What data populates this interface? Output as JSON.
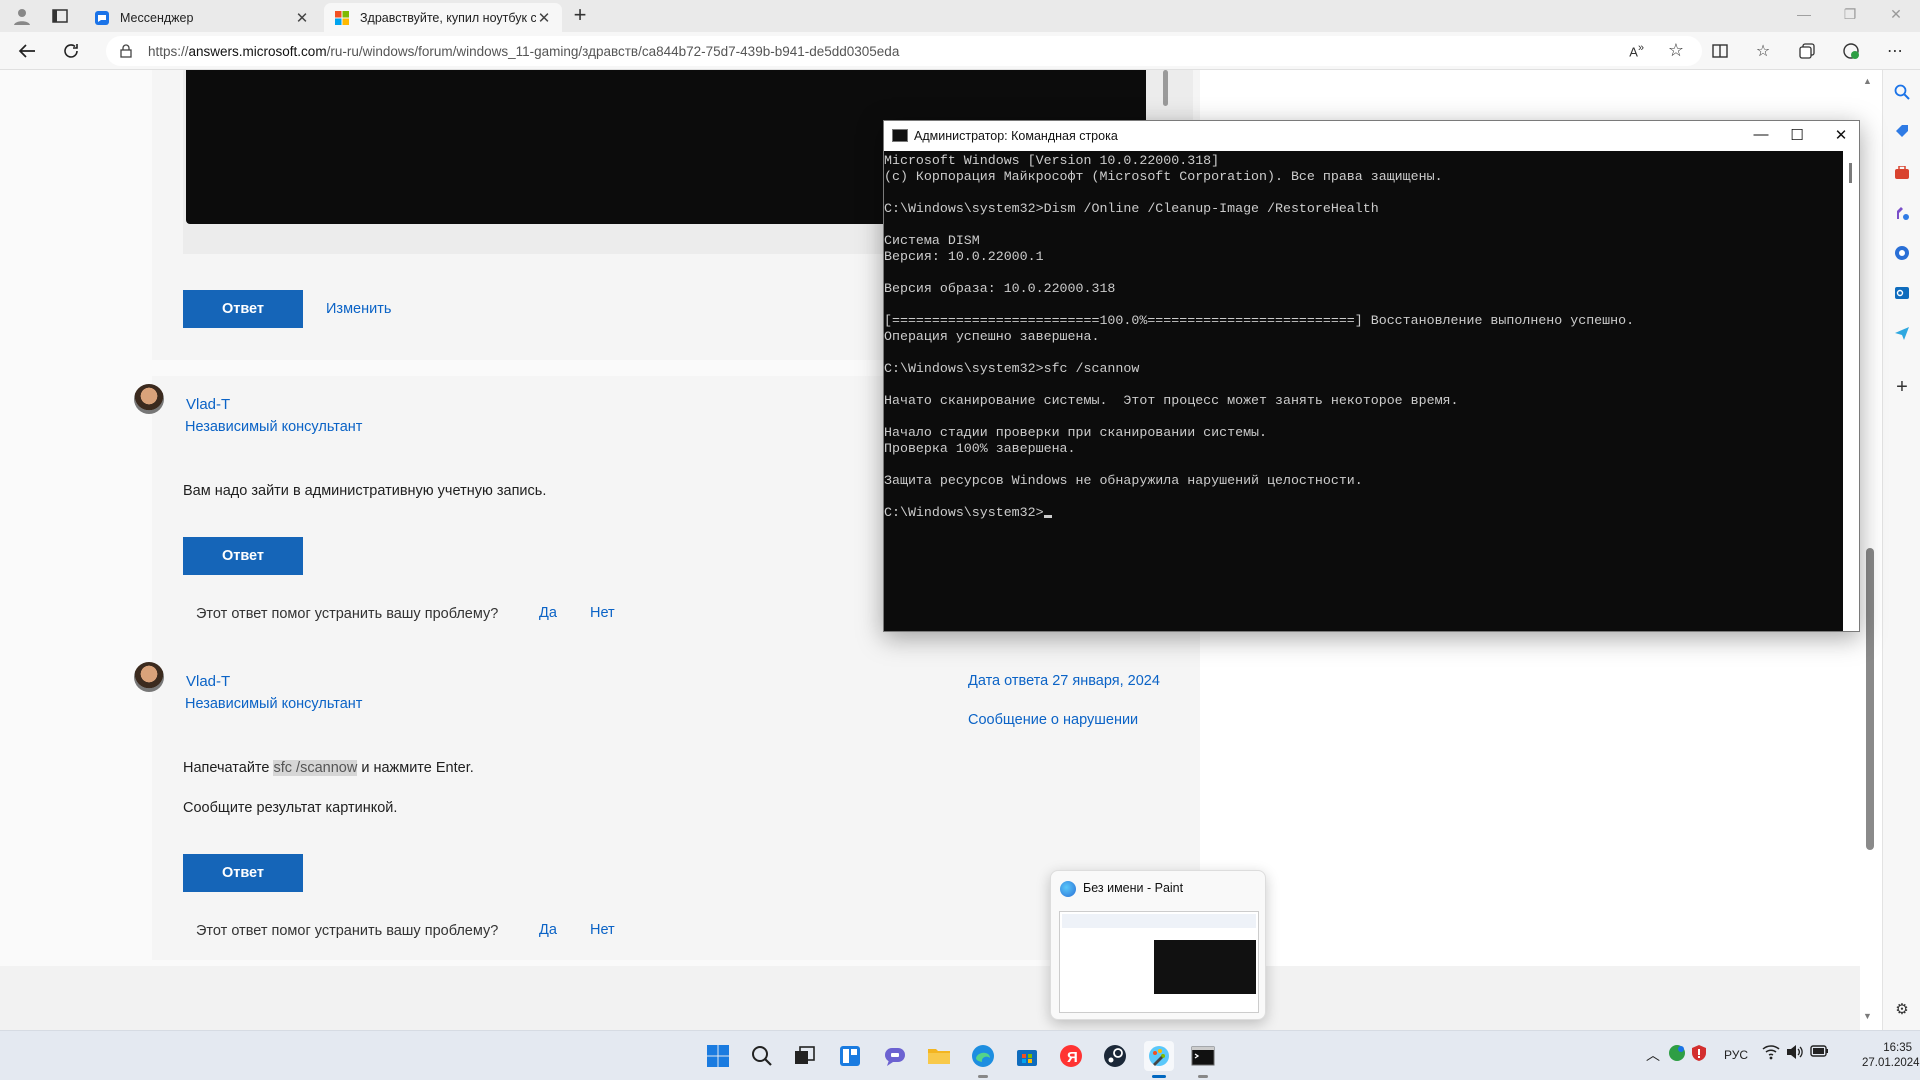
{
  "browser": {
    "tabs": [
      {
        "title": "Мессенджер"
      },
      {
        "title": "Здравствуйте, купил ноутбук с п"
      }
    ],
    "url_prefix": "https://",
    "url_host": "answers.microsoft.com",
    "url_path": "/ru-ru/windows/forum/windows_11-gaming/здравств/ca844b72-75d7-439b-b941-de5dd0305eda"
  },
  "forum": {
    "reply_label": "Ответ",
    "edit_label": "Изменить",
    "helpful_question": "Этот ответ помог устранить вашу проблему?",
    "yes": "Да",
    "no": "Нет",
    "posts": [
      {
        "author": "Vlad-T",
        "role": "Независимый консультант",
        "text": "Вам надо зайти в административную учетную запись."
      },
      {
        "author": "Vlad-T",
        "role": "Независимый консультант",
        "date": "Дата ответа 27 января, 2024",
        "report": "Сообщение о нарушении",
        "text_before": "Напечатайте ",
        "text_code": "sfc /scannow",
        "text_after": " и нажмите Enter.",
        "text2": "Сообщите результат картинкой."
      }
    ]
  },
  "cmd": {
    "title": "Администратор: Командная строка",
    "lines": [
      "Microsoft Windows [Version 10.0.22000.318]",
      "(c) Корпорация Майкрософт (Microsoft Corporation). Все права защищены.",
      "",
      "C:\\Windows\\system32>Dism /Online /Cleanup-Image /RestoreHealth",
      "",
      "Cистема DISM",
      "Версия: 10.0.22000.1",
      "",
      "Версия образа: 10.0.22000.318",
      "",
      "[==========================100.0%==========================] Восстановление выполнено успешно.",
      "Операция успешно завершена.",
      "",
      "C:\\Windows\\system32>sfc /scannow",
      "",
      "Начато сканирование системы.  Этот процесс может занять некоторое время.",
      "",
      "Начало стадии проверки при сканировании системы.",
      "Проверка 100% завершена.",
      "",
      "Защита ресурсов Windows не обнаружила нарушений целостности.",
      ""
    ],
    "prompt": "C:\\Windows\\system32>"
  },
  "paint_preview": {
    "title": "Без имени - Paint"
  },
  "taskbar": {
    "lang": "РУС",
    "time": "16:35",
    "date": "27.01.2024"
  },
  "colors": {
    "accent": "#1565b8",
    "link": "#0b63c6",
    "cmd_bg": "#0c0c0c",
    "cmd_fg": "#cccccc"
  }
}
